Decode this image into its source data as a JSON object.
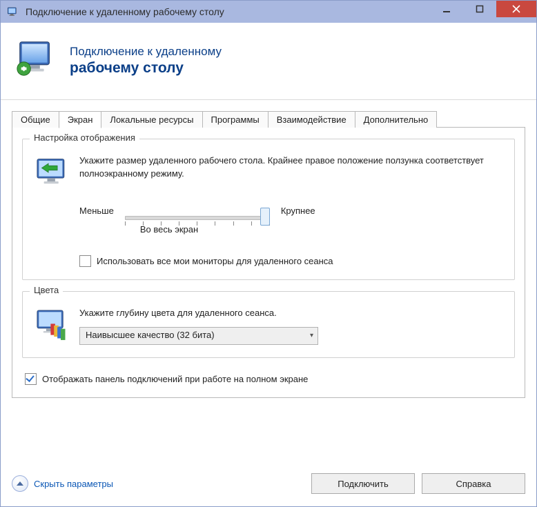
{
  "window": {
    "title": "Подключение к удаленному рабочему столу"
  },
  "banner": {
    "line1": "Подключение к удаленному",
    "line2": "рабочему столу"
  },
  "tabs": {
    "general": "Общие",
    "display": "Экран",
    "local": "Локальные ресурсы",
    "programs": "Программы",
    "experience": "Взаимодействие",
    "advanced": "Дополнительно"
  },
  "display_group": {
    "legend": "Настройка отображения",
    "desc": "Укажите размер удаленного рабочего стола. Крайнее правое положение ползунка соответствует полноэкранному режиму.",
    "less": "Меньше",
    "more": "Крупнее",
    "value_label": "Во весь экран",
    "use_all_monitors": "Использовать все мои мониторы для удаленного сеанса",
    "use_all_monitors_checked": false,
    "slider": {
      "min": 0,
      "max": 8,
      "value": 8
    }
  },
  "colors_group": {
    "legend": "Цвета",
    "desc": "Укажите глубину цвета для удаленного сеанса.",
    "selected": "Наивысшее качество (32 бита)"
  },
  "show_connection_bar": {
    "label": "Отображать панель подключений при работе на полном экране",
    "checked": true
  },
  "bottom": {
    "hide_params": "Скрыть параметры",
    "connect": "Подключить",
    "help": "Справка"
  }
}
